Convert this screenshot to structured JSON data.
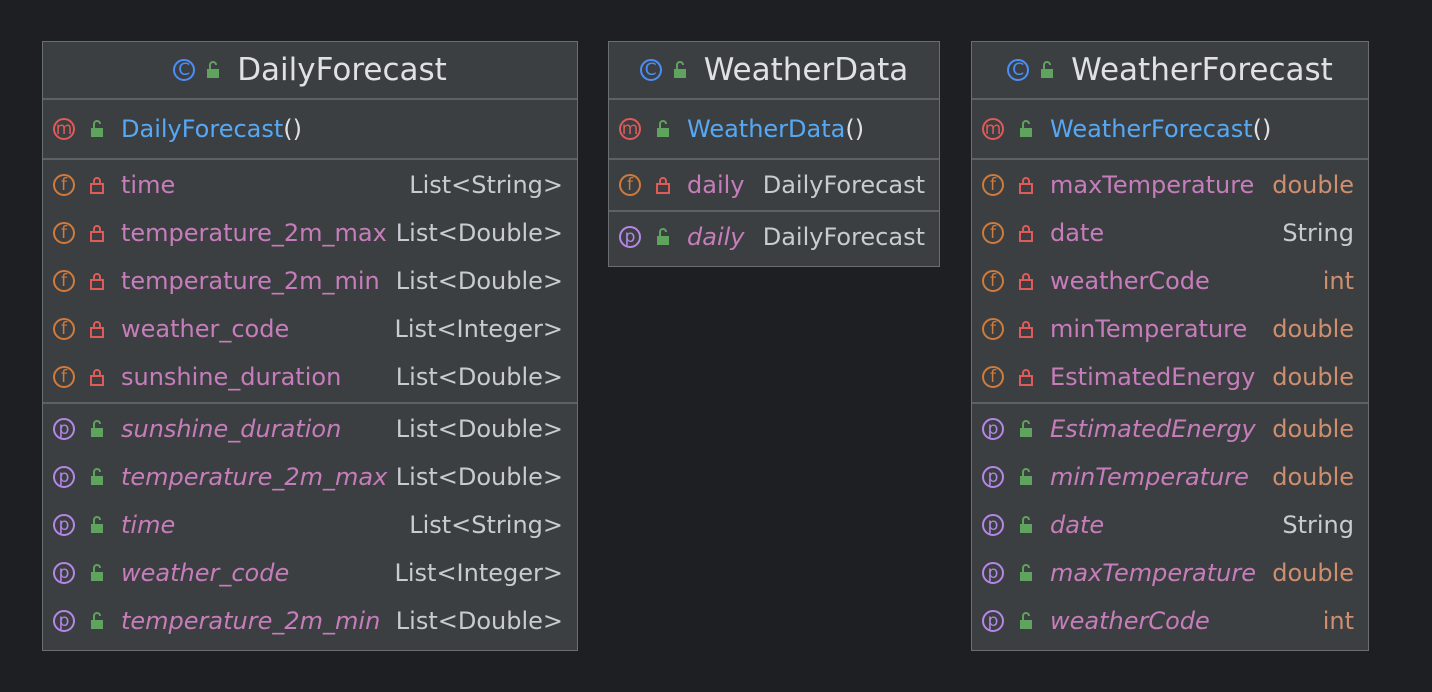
{
  "icons": {
    "class": "class-icon",
    "method": "method-icon",
    "field": "field-icon",
    "property": "property-icon",
    "public": "unlocked-icon",
    "private": "lock-icon"
  },
  "badges": {
    "class": "C",
    "method": "m",
    "field": "f",
    "property": "p"
  },
  "colors": {
    "background": "#1e1f22",
    "box": "#3c3f41",
    "method_name": "#56a8f5",
    "member_name": "#c77dbb",
    "primitive_type": "#cf8e6d",
    "public_icon": "#5fa35f",
    "private_icon": "#e05a5a"
  },
  "classes": [
    {
      "name": "DailyForecast",
      "constructor": {
        "name": "DailyForecast",
        "parens": "()"
      },
      "fields": [
        {
          "name": "time",
          "type": "List<String>"
        },
        {
          "name": "temperature_2m_max",
          "type": "List<Double>"
        },
        {
          "name": "temperature_2m_min",
          "type": "List<Double>"
        },
        {
          "name": "weather_code",
          "type": "List<Integer>"
        },
        {
          "name": "sunshine_duration",
          "type": "List<Double>"
        }
      ],
      "properties": [
        {
          "name": "sunshine_duration",
          "type": "List<Double>"
        },
        {
          "name": "temperature_2m_max",
          "type": "List<Double>"
        },
        {
          "name": "time",
          "type": "List<String>"
        },
        {
          "name": "weather_code",
          "type": "List<Integer>"
        },
        {
          "name": "temperature_2m_min",
          "type": "List<Double>"
        }
      ]
    },
    {
      "name": "WeatherData",
      "constructor": {
        "name": "WeatherData",
        "parens": "()"
      },
      "fields": [
        {
          "name": "daily",
          "type": "DailyForecast"
        }
      ],
      "properties": [
        {
          "name": "daily",
          "type": "DailyForecast"
        }
      ]
    },
    {
      "name": "WeatherForecast",
      "constructor": {
        "name": "WeatherForecast",
        "parens": "()"
      },
      "fields": [
        {
          "name": "maxTemperature",
          "type": "double"
        },
        {
          "name": "date",
          "type": "String"
        },
        {
          "name": "weatherCode",
          "type": "int"
        },
        {
          "name": "minTemperature",
          "type": "double"
        },
        {
          "name": "EstimatedEnergy",
          "type": "double"
        }
      ],
      "properties": [
        {
          "name": "EstimatedEnergy",
          "type": "double"
        },
        {
          "name": "minTemperature",
          "type": "double"
        },
        {
          "name": "date",
          "type": "String"
        },
        {
          "name": "maxTemperature",
          "type": "double"
        },
        {
          "name": "weatherCode",
          "type": "int"
        }
      ]
    }
  ]
}
